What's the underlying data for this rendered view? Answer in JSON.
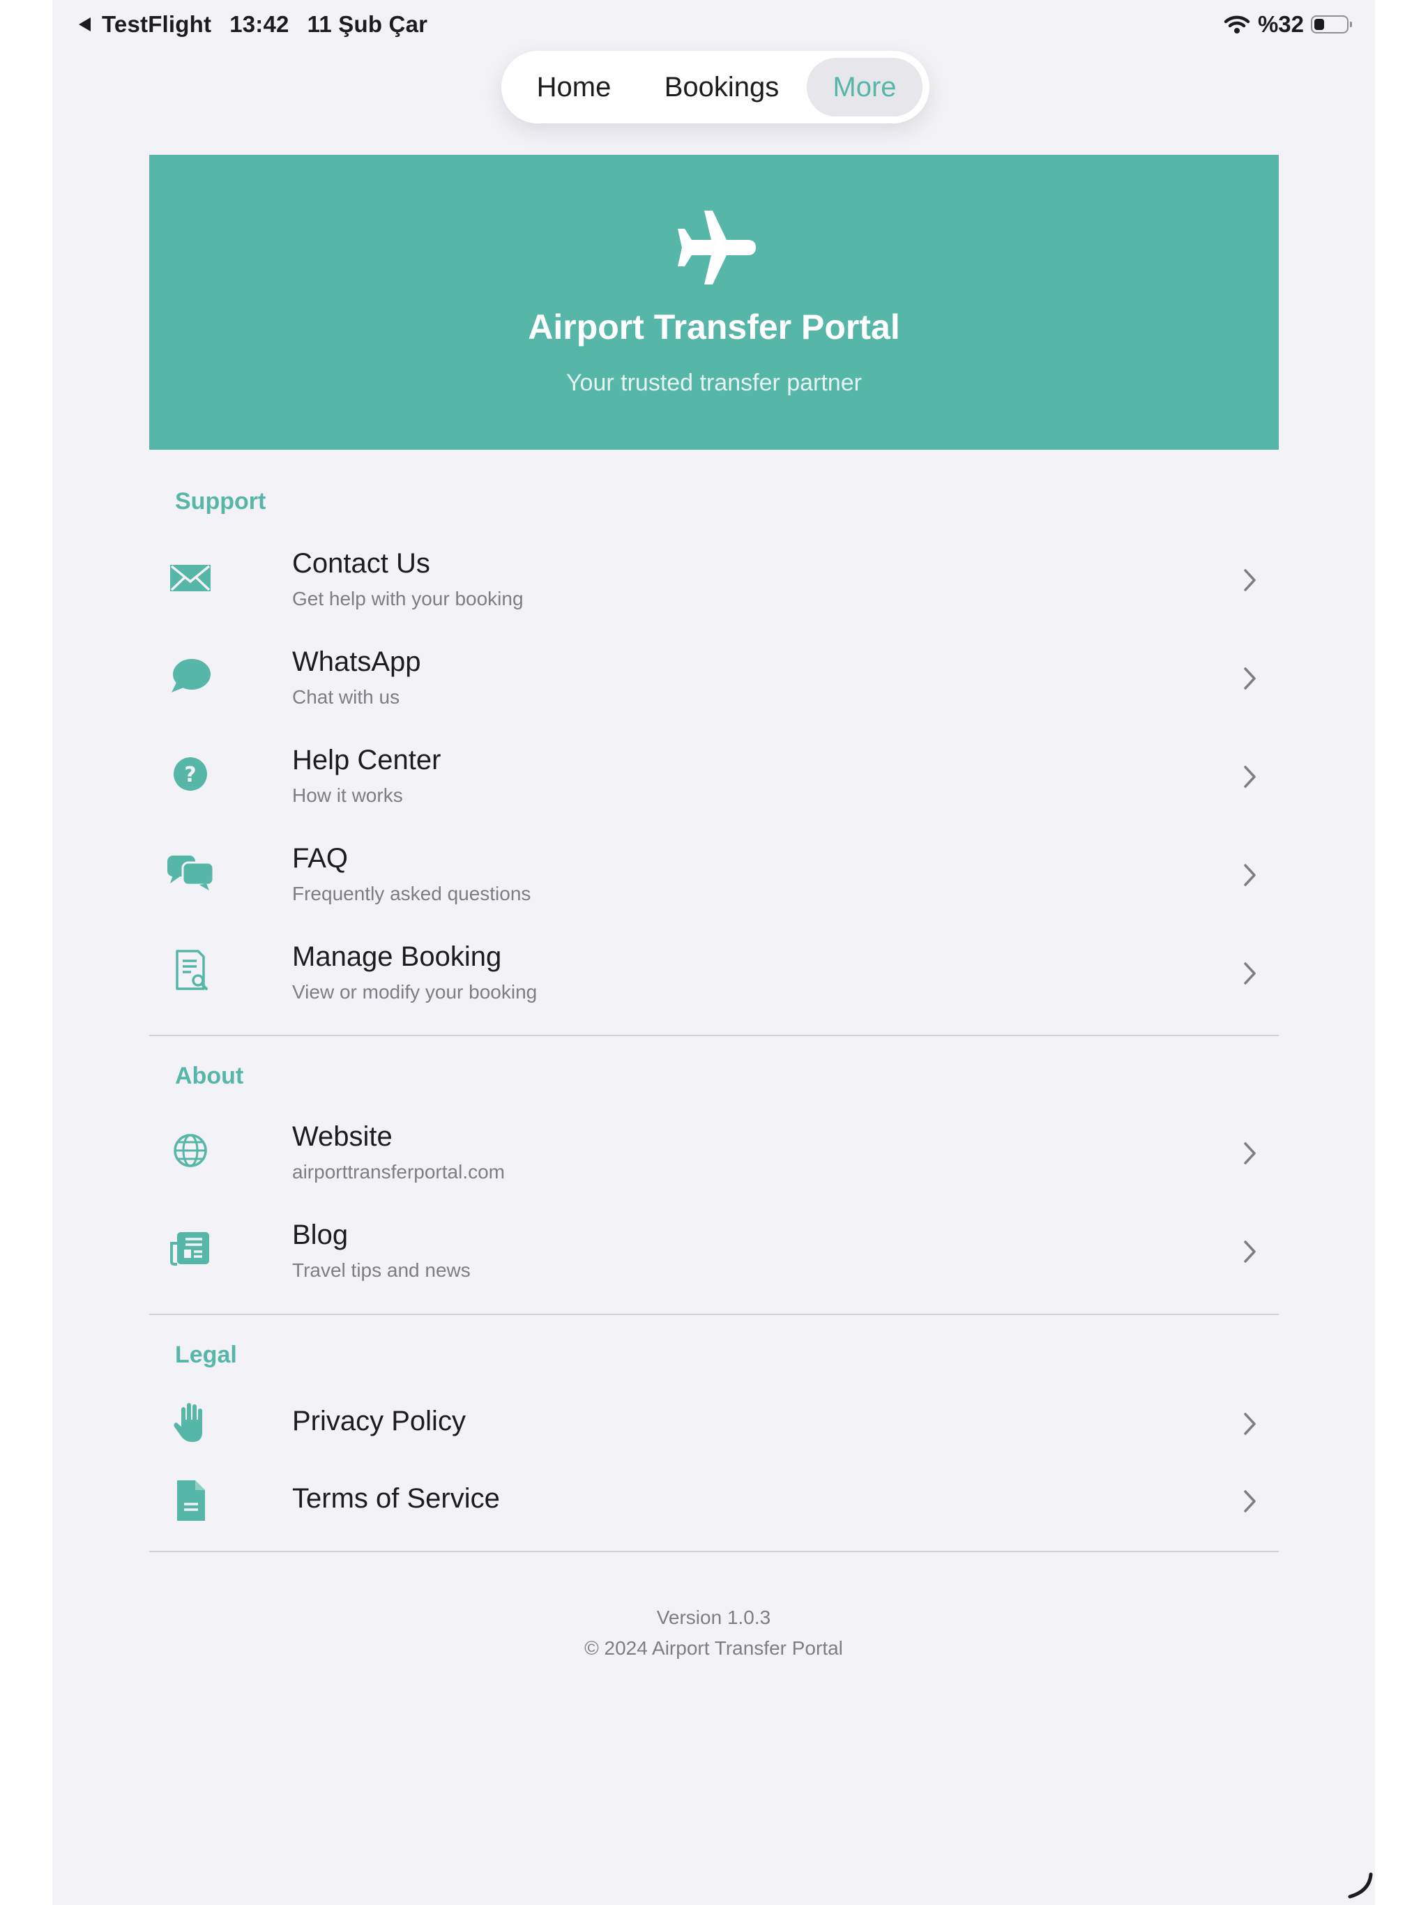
{
  "status_bar": {
    "back_app": "TestFlight",
    "time": "13:42",
    "date": "11 Şub Çar",
    "battery": "%32",
    "battery_level_percent": 32
  },
  "nav": {
    "tabs": [
      {
        "label": "Home",
        "active": false
      },
      {
        "label": "Bookings",
        "active": false
      },
      {
        "label": "More",
        "active": true
      }
    ]
  },
  "hero": {
    "icon": "airplane-icon",
    "title": "Airport Transfer Portal",
    "subtitle": "Your trusted transfer partner"
  },
  "sections": {
    "support": {
      "header": "Support",
      "items": [
        {
          "title": "Contact Us",
          "subtitle": "Get help with your booking",
          "icon": "envelope-icon"
        },
        {
          "title": "WhatsApp",
          "subtitle": "Chat with us",
          "icon": "chat-bubble-icon"
        },
        {
          "title": "Help Center",
          "subtitle": "How it works",
          "icon": "question-circle-icon"
        },
        {
          "title": "FAQ",
          "subtitle": "Frequently asked questions",
          "icon": "comments-icon"
        },
        {
          "title": "Manage Booking",
          "subtitle": "View or modify your booking",
          "icon": "document-search-icon"
        }
      ]
    },
    "about": {
      "header": "About",
      "items": [
        {
          "title": "Website",
          "subtitle": "airporttransferportal.com",
          "icon": "globe-icon"
        },
        {
          "title": "Blog",
          "subtitle": "Travel tips and news",
          "icon": "newspaper-icon"
        }
      ]
    },
    "legal": {
      "header": "Legal",
      "items": [
        {
          "title": "Privacy Policy",
          "icon": "hand-icon"
        },
        {
          "title": "Terms of Service",
          "icon": "file-text-icon"
        }
      ]
    }
  },
  "footer": {
    "version": "Version 1.0.3",
    "copyright": "© 2024 Airport Transfer Portal"
  },
  "colors": {
    "accent": "#56b6a7",
    "background": "#f2f2f7",
    "text": "#1c1c1e",
    "secondary_text": "#7d7d82"
  }
}
